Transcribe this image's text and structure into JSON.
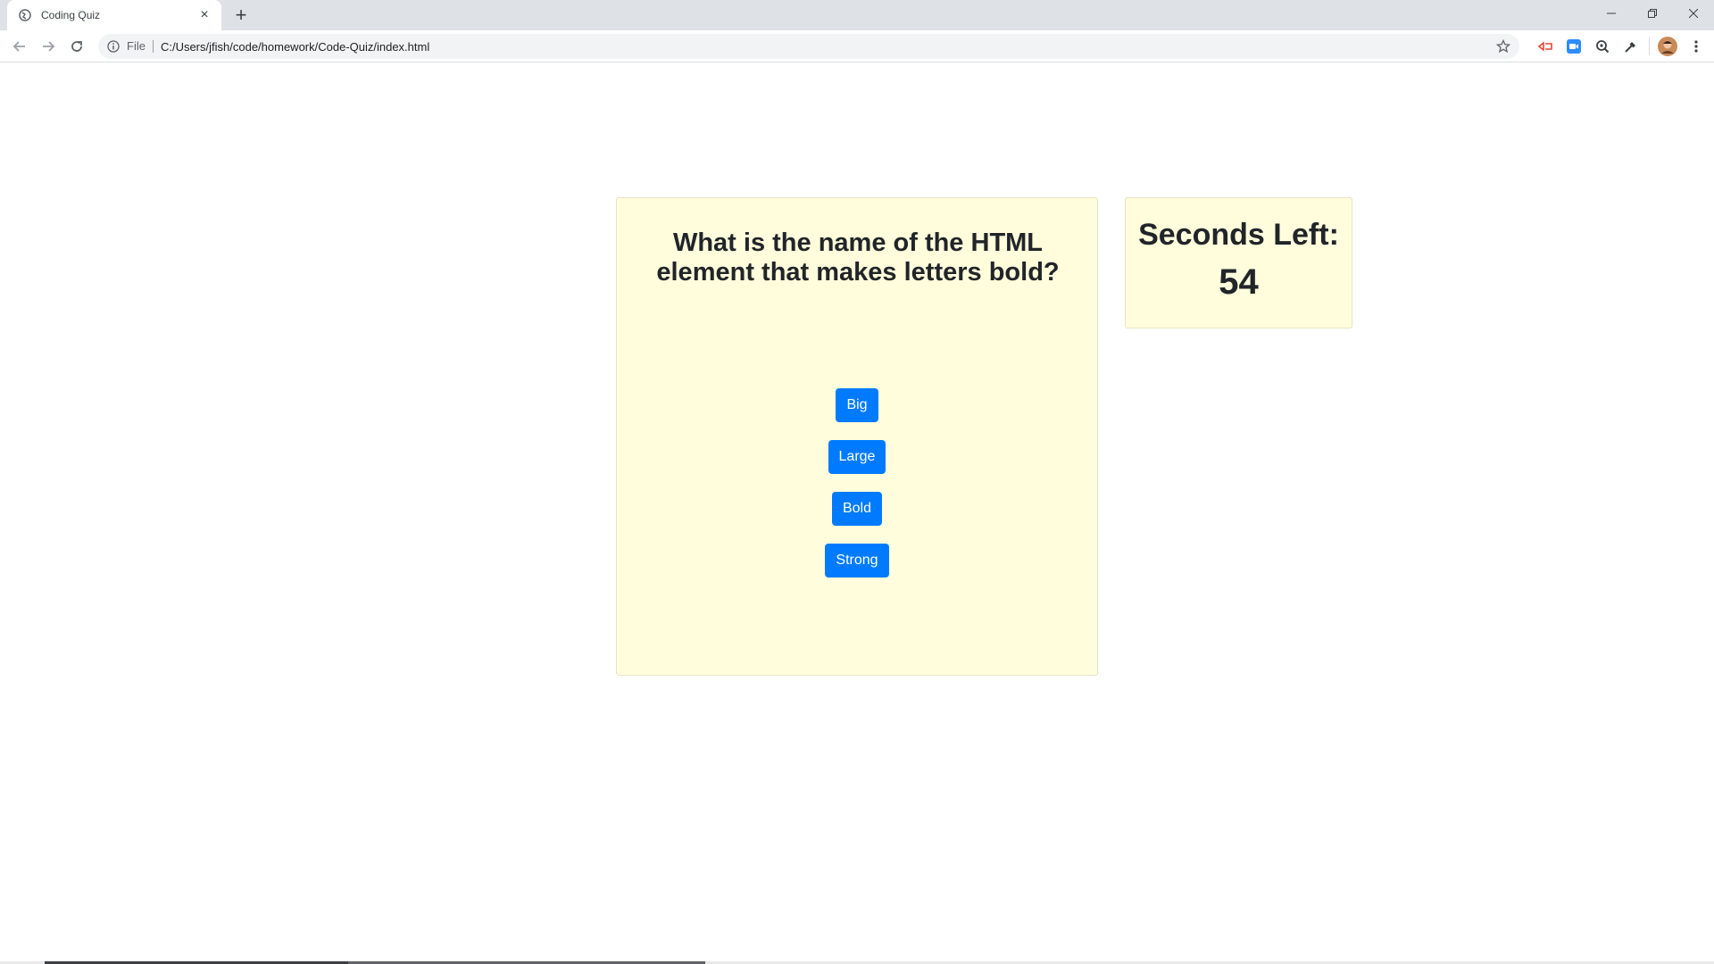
{
  "browser": {
    "tab_title": "Coding Quiz",
    "tab_close": "×",
    "new_tab": "+",
    "omnibox": {
      "scheme_label": "File",
      "url": "C:/Users/jfish/code/homework/Code-Quiz/index.html"
    },
    "extensions": [
      "cast-icon",
      "zoom-icon",
      "magnifier-icon",
      "eyedropper-icon"
    ],
    "window_controls": [
      "minimize",
      "restore",
      "close"
    ]
  },
  "quiz": {
    "question": "What is the name of the HTML element that makes letters bold?",
    "choices": [
      "Big",
      "Large",
      "Bold",
      "Strong"
    ],
    "accent_color": "#007bff",
    "card_color": "#fffddc"
  },
  "timer": {
    "label": "Seconds Left:",
    "value": "54"
  }
}
